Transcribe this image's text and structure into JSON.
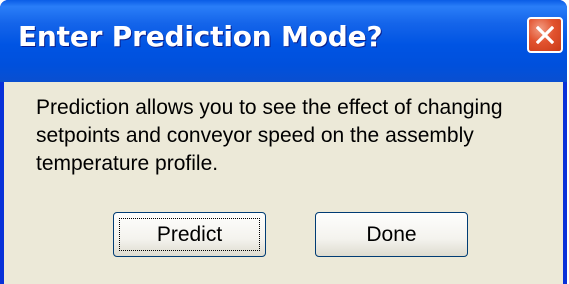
{
  "dialog": {
    "title": "Enter Prediction Mode?",
    "close_icon": "close-x-icon",
    "message": "Prediction allows you to see the effect of changing setpoints and conveyor speed on the assembly temperature profile.",
    "buttons": {
      "predict_label": "Predict",
      "done_label": "Done"
    }
  },
  "colors": {
    "titlebar": "#0054e3",
    "close_button": "#e2532f",
    "client_background": "#ece9d8",
    "button_border": "#003c74"
  }
}
